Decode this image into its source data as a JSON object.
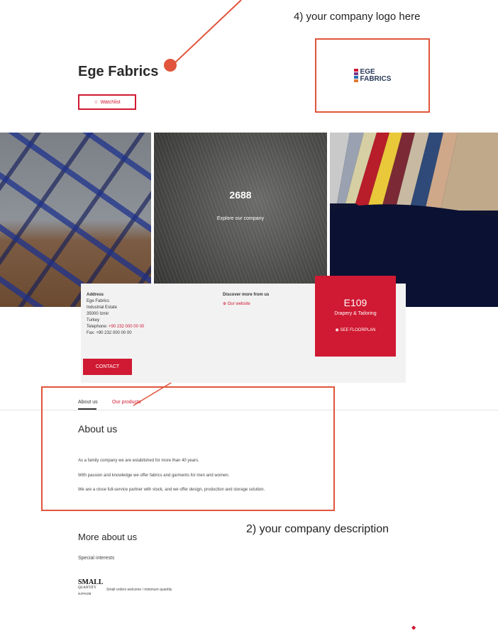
{
  "annotations": {
    "logo_hint": "4) your company logo here",
    "description_hint": "2) your company description"
  },
  "company": {
    "name": "Ege Fabrics",
    "watchlist_label": "Watchlist",
    "logo_line1": "EGE",
    "logo_line2": "FABRICS"
  },
  "hero": {
    "number": "2688",
    "link_label": "Explore our company"
  },
  "info": {
    "address_heading": "Address",
    "address_lines": [
      "Ege Fabrics",
      "Industrial Estate",
      "35000 Izmir",
      "Turkey"
    ],
    "telephone_label": "Telephone:",
    "telephone_value": "+90 232 000 00 00",
    "fax_label": "Fax: +90 232 000 00 00",
    "discover_heading": "Discover more from us",
    "website_label": "Our website",
    "contact_label": "CONTACT"
  },
  "stand": {
    "number": "E109",
    "category": "Drapery & Tailoring",
    "floorplan_label": "SEE FLOORPLAN"
  },
  "tabs": {
    "about": "About us",
    "products": "Our products"
  },
  "about": {
    "heading": "About us",
    "p1": "As a family company we are established for more than 40 years.",
    "p2": "With passion and knowledge we offer fabrics and garments for men and women.",
    "p3": "We are a close full-service partner with stock, and we offer design, production and storage solution."
  },
  "more": {
    "heading": "More about us",
    "special_label": "Special interests",
    "badge_line1": "SMALL",
    "badge_line2": "QUANTITY",
    "badge_line3": "SUPPLIER",
    "badge_caption": "Small orders welcome / minimum quantity"
  },
  "colors": {
    "accent": "#d01932",
    "annotation": "#e0553b",
    "card_bg": "#f2f2f2"
  }
}
